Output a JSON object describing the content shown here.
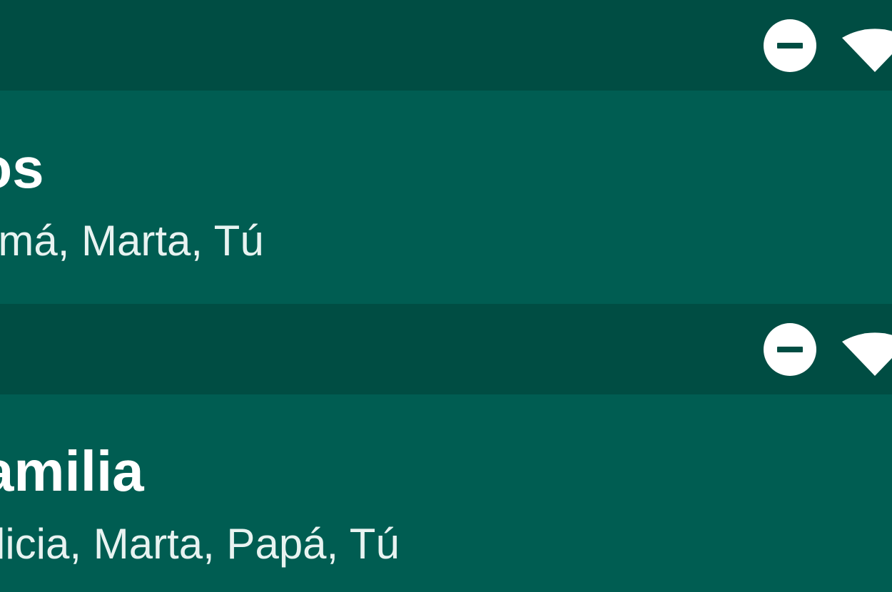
{
  "status_bar": {
    "icons": [
      "do-not-disturb-icon",
      "wifi-icon"
    ],
    "color": "#004d43"
  },
  "chats": [
    {
      "title": "Hijos",
      "members": "Mamá, Marta, Tú"
    },
    {
      "title": "Familia",
      "members": "Alicia, Marta, Papá, Tú"
    }
  ],
  "colors": {
    "app_bar": "#005d52",
    "status_bar": "#004d43",
    "text": "#ffffff"
  }
}
